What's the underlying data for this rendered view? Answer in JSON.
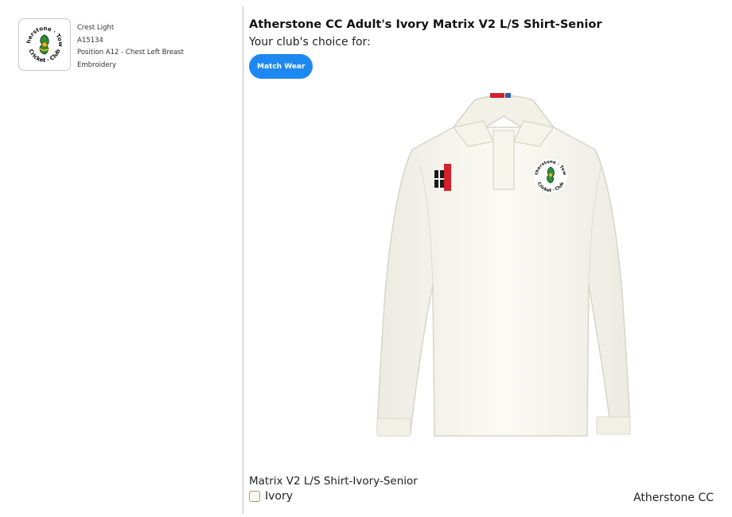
{
  "crest": {
    "name": "Crest Light",
    "code": "A15134",
    "position": "Position A12 - Chest Left Breast",
    "method": "Embroidery",
    "icon": "club-crest-logo",
    "logo_text": "Atherstone · Town · Cricket · Club"
  },
  "product": {
    "title": "Atherstone CC Adult's Ivory Matrix V2 L/S Shirt-Senior",
    "choice_label": "Your club's choice for:",
    "category_button": "Match Wear",
    "image_icon": "long-sleeve-cricket-shirt",
    "variant_name": "Matrix V2 L/S Shirt-Ivory-Senior",
    "colour": {
      "label": "Ivory",
      "swatch": "#fbf7ea"
    },
    "club_name": "Atherstone CC"
  },
  "colors": {
    "accent_button": "#1e88f0",
    "shirt_ivory": "#f7f5ec",
    "badge_red": "#d4202c",
    "crest_green": "#2f8f3a"
  }
}
